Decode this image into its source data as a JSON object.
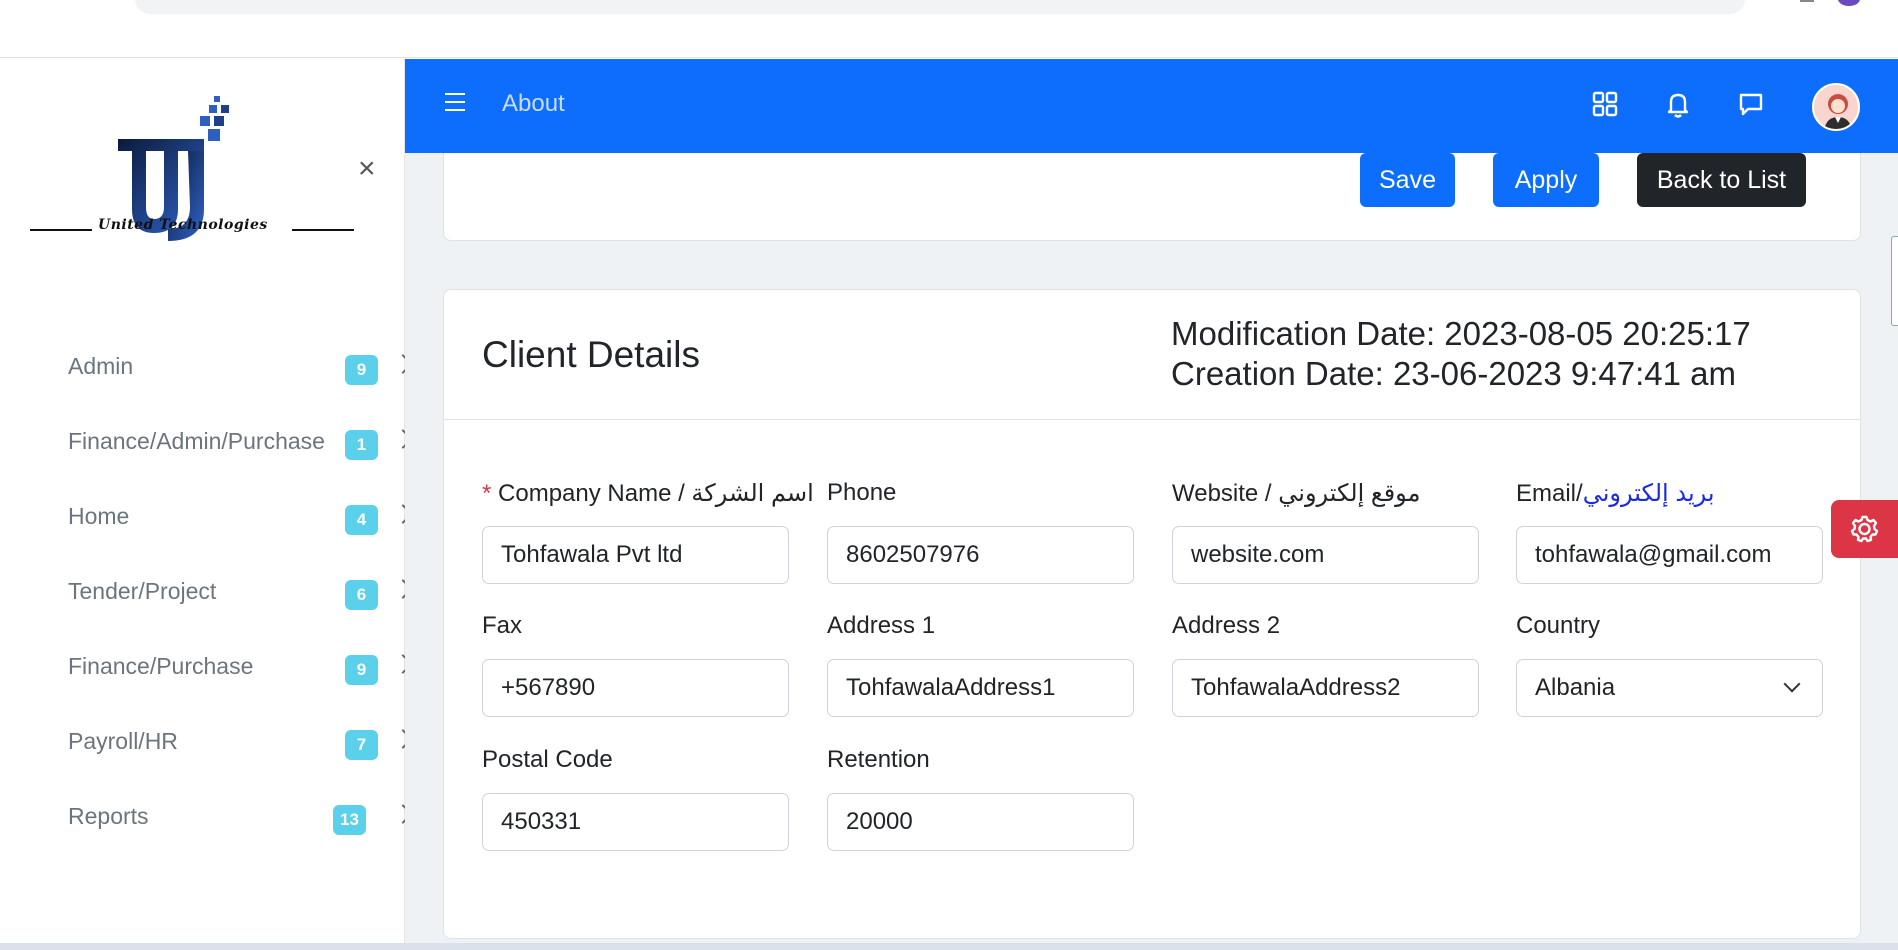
{
  "header": {
    "title": "About",
    "icons": [
      "menu-icon",
      "apps-grid-icon",
      "bell-icon",
      "chat-icon",
      "user-avatar"
    ]
  },
  "brand": {
    "logo_text": "United Technologies"
  },
  "sidebar": {
    "items": [
      {
        "label": "Admin",
        "badge": "9"
      },
      {
        "label": "Finance/Admin/Purchase",
        "badge": "1"
      },
      {
        "label": "Home",
        "badge": "4"
      },
      {
        "label": "Tender/Project",
        "badge": "6"
      },
      {
        "label": "Finance/Purchase",
        "badge": "9"
      },
      {
        "label": "Payroll/HR",
        "badge": "7"
      },
      {
        "label": "Reports",
        "badge": "13"
      }
    ]
  },
  "actions": {
    "save": "Save",
    "apply": "Apply",
    "back": "Back to List"
  },
  "card": {
    "title": "Client Details",
    "modification_date": "Modification Date: 2023-08-05 20:25:17",
    "creation_date": "Creation Date: 23-06-2023 9:47:41 am"
  },
  "form": {
    "company_name": {
      "required_mark": "*",
      "label": "Company Name / اسم الشركة",
      "value": "Tohfawala Pvt ltd"
    },
    "phone": {
      "label": "Phone",
      "value": "8602507976"
    },
    "website": {
      "label": "Website / موقع إلكتروني",
      "value": "website.com"
    },
    "email": {
      "label_en": "Email/",
      "label_ar": "بريد إلكتروني",
      "value": "tohfawala@gmail.com"
    },
    "fax": {
      "label": "Fax",
      "value": "+567890"
    },
    "address1": {
      "label": "Address 1",
      "value": "TohfawalaAddress1"
    },
    "address2": {
      "label": "Address 2",
      "value": "TohfawalaAddress2"
    },
    "country": {
      "label": "Country",
      "value": "Albania"
    },
    "postal_code": {
      "label": "Postal Code",
      "value": "450331"
    },
    "retention": {
      "label": "Retention",
      "value": "20000"
    }
  },
  "colors": {
    "primary": "#0d6efd",
    "dark": "#212529",
    "badge": "#5bd0ea",
    "danger": "#dc3545",
    "content_bg": "#eef2f5"
  }
}
